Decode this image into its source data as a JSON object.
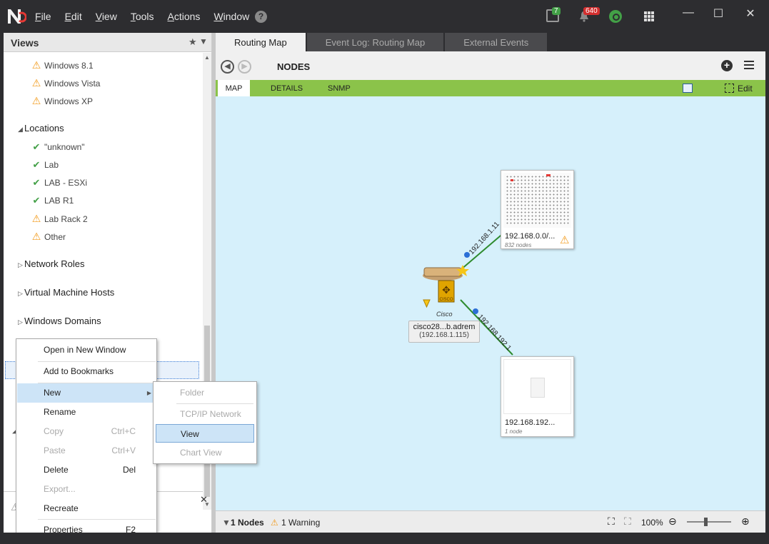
{
  "menu": [
    "File",
    "Edit",
    "View",
    "Tools",
    "Actions",
    "Window"
  ],
  "help": "?",
  "badges": {
    "clipboard": "7",
    "alerts": "640"
  },
  "window_controls": {
    "minimize": "—",
    "maximize": "☐",
    "close": "✕"
  },
  "views_panel": {
    "title": "Views",
    "os_items": [
      {
        "label": "Windows 8.1",
        "status": "warning"
      },
      {
        "label": "Windows Vista",
        "status": "warning"
      },
      {
        "label": "Windows XP",
        "status": "warning"
      }
    ],
    "locations_label": "Locations",
    "location_items": [
      {
        "label": "\"unknown\"",
        "status": "ok"
      },
      {
        "label": "Lab",
        "status": "ok"
      },
      {
        "label": "LAB - ESXi",
        "status": "ok"
      },
      {
        "label": "LAB R1",
        "status": "ok"
      },
      {
        "label": "Lab Rack 2",
        "status": "warning"
      },
      {
        "label": "Other",
        "status": "warning"
      }
    ],
    "groups": [
      "Network Roles",
      "Virtual Machine Hosts",
      "Windows Domains"
    ]
  },
  "tabs": [
    {
      "label": "Routing Map",
      "active": true
    },
    {
      "label": "Event Log: Routing Map",
      "active": false
    },
    {
      "label": "External Events",
      "active": false
    }
  ],
  "nav": {
    "title": "NODES"
  },
  "subtabs": {
    "map": "MAP",
    "details": "DETAILS",
    "snmp": "SNMP",
    "edit": "Edit"
  },
  "map": {
    "subnet_top": {
      "label": "192.168.0.0/...",
      "sub": "832 nodes",
      "link": "192.168.1.11"
    },
    "subnet_bottom": {
      "label": "192.168.192...",
      "sub": "1 node",
      "link": "192.168.192.1"
    },
    "router": {
      "caption": "Cisco",
      "name": "cisco28...b.adrem",
      "ip": "(192.168.1.115)"
    }
  },
  "status": {
    "nodes": "1 Nodes",
    "warnings": "1 Warning",
    "zoom": "100%"
  },
  "context_menu": {
    "items": [
      {
        "label": "Open in New Window",
        "shortcut": "",
        "disabled": false
      },
      {
        "label": "Add to Bookmarks",
        "shortcut": "",
        "disabled": false
      },
      {
        "label": "New",
        "shortcut": "",
        "disabled": false
      },
      {
        "label": "Rename",
        "shortcut": "",
        "disabled": false
      },
      {
        "label": "Copy",
        "shortcut": "Ctrl+C",
        "disabled": true
      },
      {
        "label": "Paste",
        "shortcut": "Ctrl+V",
        "disabled": true
      },
      {
        "label": "Delete",
        "shortcut": "Del",
        "disabled": false
      },
      {
        "label": "Export...",
        "shortcut": "",
        "disabled": true
      },
      {
        "label": "Recreate",
        "shortcut": "",
        "disabled": false
      },
      {
        "label": "Properties",
        "shortcut": "F2",
        "disabled": false
      }
    ]
  },
  "sub_menu": {
    "items": [
      {
        "label": "Folder",
        "disabled": true
      },
      {
        "label": "TCP/IP Network",
        "disabled": true
      },
      {
        "label": "View",
        "disabled": false
      },
      {
        "label": "Chart View",
        "disabled": true
      }
    ]
  }
}
